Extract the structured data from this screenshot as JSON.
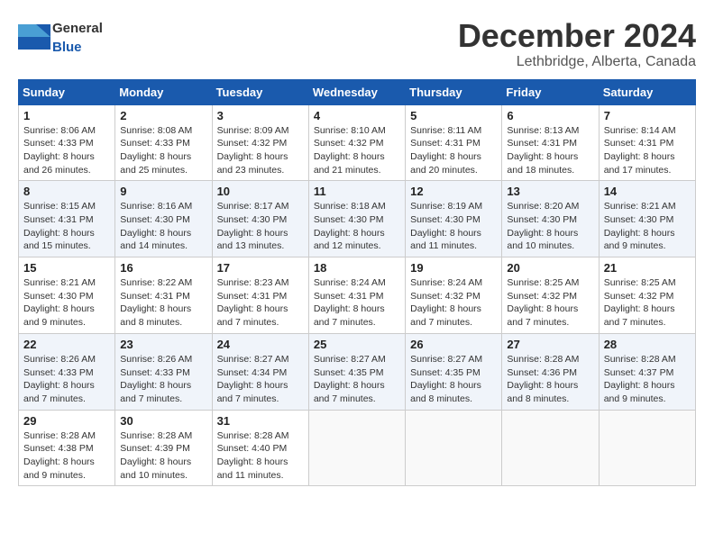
{
  "header": {
    "logo_general": "General",
    "logo_blue": "Blue",
    "month_title": "December 2024",
    "location": "Lethbridge, Alberta, Canada"
  },
  "weekdays": [
    "Sunday",
    "Monday",
    "Tuesday",
    "Wednesday",
    "Thursday",
    "Friday",
    "Saturday"
  ],
  "weeks": [
    [
      {
        "day": "1",
        "sunrise": "Sunrise: 8:06 AM",
        "sunset": "Sunset: 4:33 PM",
        "daylight": "Daylight: 8 hours and 26 minutes."
      },
      {
        "day": "2",
        "sunrise": "Sunrise: 8:08 AM",
        "sunset": "Sunset: 4:33 PM",
        "daylight": "Daylight: 8 hours and 25 minutes."
      },
      {
        "day": "3",
        "sunrise": "Sunrise: 8:09 AM",
        "sunset": "Sunset: 4:32 PM",
        "daylight": "Daylight: 8 hours and 23 minutes."
      },
      {
        "day": "4",
        "sunrise": "Sunrise: 8:10 AM",
        "sunset": "Sunset: 4:32 PM",
        "daylight": "Daylight: 8 hours and 21 minutes."
      },
      {
        "day": "5",
        "sunrise": "Sunrise: 8:11 AM",
        "sunset": "Sunset: 4:31 PM",
        "daylight": "Daylight: 8 hours and 20 minutes."
      },
      {
        "day": "6",
        "sunrise": "Sunrise: 8:13 AM",
        "sunset": "Sunset: 4:31 PM",
        "daylight": "Daylight: 8 hours and 18 minutes."
      },
      {
        "day": "7",
        "sunrise": "Sunrise: 8:14 AM",
        "sunset": "Sunset: 4:31 PM",
        "daylight": "Daylight: 8 hours and 17 minutes."
      }
    ],
    [
      {
        "day": "8",
        "sunrise": "Sunrise: 8:15 AM",
        "sunset": "Sunset: 4:31 PM",
        "daylight": "Daylight: 8 hours and 15 minutes."
      },
      {
        "day": "9",
        "sunrise": "Sunrise: 8:16 AM",
        "sunset": "Sunset: 4:30 PM",
        "daylight": "Daylight: 8 hours and 14 minutes."
      },
      {
        "day": "10",
        "sunrise": "Sunrise: 8:17 AM",
        "sunset": "Sunset: 4:30 PM",
        "daylight": "Daylight: 8 hours and 13 minutes."
      },
      {
        "day": "11",
        "sunrise": "Sunrise: 8:18 AM",
        "sunset": "Sunset: 4:30 PM",
        "daylight": "Daylight: 8 hours and 12 minutes."
      },
      {
        "day": "12",
        "sunrise": "Sunrise: 8:19 AM",
        "sunset": "Sunset: 4:30 PM",
        "daylight": "Daylight: 8 hours and 11 minutes."
      },
      {
        "day": "13",
        "sunrise": "Sunrise: 8:20 AM",
        "sunset": "Sunset: 4:30 PM",
        "daylight": "Daylight: 8 hours and 10 minutes."
      },
      {
        "day": "14",
        "sunrise": "Sunrise: 8:21 AM",
        "sunset": "Sunset: 4:30 PM",
        "daylight": "Daylight: 8 hours and 9 minutes."
      }
    ],
    [
      {
        "day": "15",
        "sunrise": "Sunrise: 8:21 AM",
        "sunset": "Sunset: 4:30 PM",
        "daylight": "Daylight: 8 hours and 9 minutes."
      },
      {
        "day": "16",
        "sunrise": "Sunrise: 8:22 AM",
        "sunset": "Sunset: 4:31 PM",
        "daylight": "Daylight: 8 hours and 8 minutes."
      },
      {
        "day": "17",
        "sunrise": "Sunrise: 8:23 AM",
        "sunset": "Sunset: 4:31 PM",
        "daylight": "Daylight: 8 hours and 7 minutes."
      },
      {
        "day": "18",
        "sunrise": "Sunrise: 8:24 AM",
        "sunset": "Sunset: 4:31 PM",
        "daylight": "Daylight: 8 hours and 7 minutes."
      },
      {
        "day": "19",
        "sunrise": "Sunrise: 8:24 AM",
        "sunset": "Sunset: 4:32 PM",
        "daylight": "Daylight: 8 hours and 7 minutes."
      },
      {
        "day": "20",
        "sunrise": "Sunrise: 8:25 AM",
        "sunset": "Sunset: 4:32 PM",
        "daylight": "Daylight: 8 hours and 7 minutes."
      },
      {
        "day": "21",
        "sunrise": "Sunrise: 8:25 AM",
        "sunset": "Sunset: 4:32 PM",
        "daylight": "Daylight: 8 hours and 7 minutes."
      }
    ],
    [
      {
        "day": "22",
        "sunrise": "Sunrise: 8:26 AM",
        "sunset": "Sunset: 4:33 PM",
        "daylight": "Daylight: 8 hours and 7 minutes."
      },
      {
        "day": "23",
        "sunrise": "Sunrise: 8:26 AM",
        "sunset": "Sunset: 4:33 PM",
        "daylight": "Daylight: 8 hours and 7 minutes."
      },
      {
        "day": "24",
        "sunrise": "Sunrise: 8:27 AM",
        "sunset": "Sunset: 4:34 PM",
        "daylight": "Daylight: 8 hours and 7 minutes."
      },
      {
        "day": "25",
        "sunrise": "Sunrise: 8:27 AM",
        "sunset": "Sunset: 4:35 PM",
        "daylight": "Daylight: 8 hours and 7 minutes."
      },
      {
        "day": "26",
        "sunrise": "Sunrise: 8:27 AM",
        "sunset": "Sunset: 4:35 PM",
        "daylight": "Daylight: 8 hours and 8 minutes."
      },
      {
        "day": "27",
        "sunrise": "Sunrise: 8:28 AM",
        "sunset": "Sunset: 4:36 PM",
        "daylight": "Daylight: 8 hours and 8 minutes."
      },
      {
        "day": "28",
        "sunrise": "Sunrise: 8:28 AM",
        "sunset": "Sunset: 4:37 PM",
        "daylight": "Daylight: 8 hours and 9 minutes."
      }
    ],
    [
      {
        "day": "29",
        "sunrise": "Sunrise: 8:28 AM",
        "sunset": "Sunset: 4:38 PM",
        "daylight": "Daylight: 8 hours and 9 minutes."
      },
      {
        "day": "30",
        "sunrise": "Sunrise: 8:28 AM",
        "sunset": "Sunset: 4:39 PM",
        "daylight": "Daylight: 8 hours and 10 minutes."
      },
      {
        "day": "31",
        "sunrise": "Sunrise: 8:28 AM",
        "sunset": "Sunset: 4:40 PM",
        "daylight": "Daylight: 8 hours and 11 minutes."
      },
      null,
      null,
      null,
      null
    ]
  ]
}
